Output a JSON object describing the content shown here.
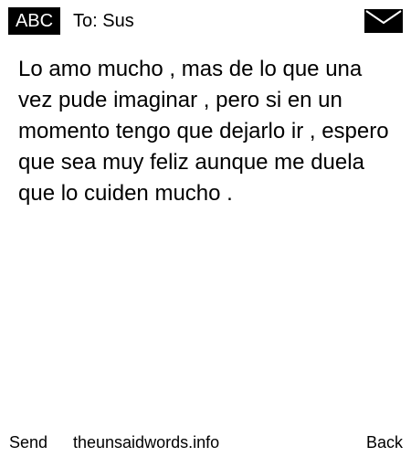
{
  "header": {
    "mode_label": "ABC",
    "recipient": "To: Sus",
    "envelope_icon": "envelope-icon"
  },
  "message": {
    "text": "Lo amo mucho , mas de lo que una vez pude imaginar , pero si en un momento tengo que dejarlo ir , espero que sea muy feliz aunque me duela que lo cuiden mucho ."
  },
  "footer": {
    "send_label": "Send",
    "site_label": "theunsaidwords.info",
    "back_label": "Back"
  },
  "colors": {
    "background": "#ffffff",
    "foreground": "#000000"
  }
}
